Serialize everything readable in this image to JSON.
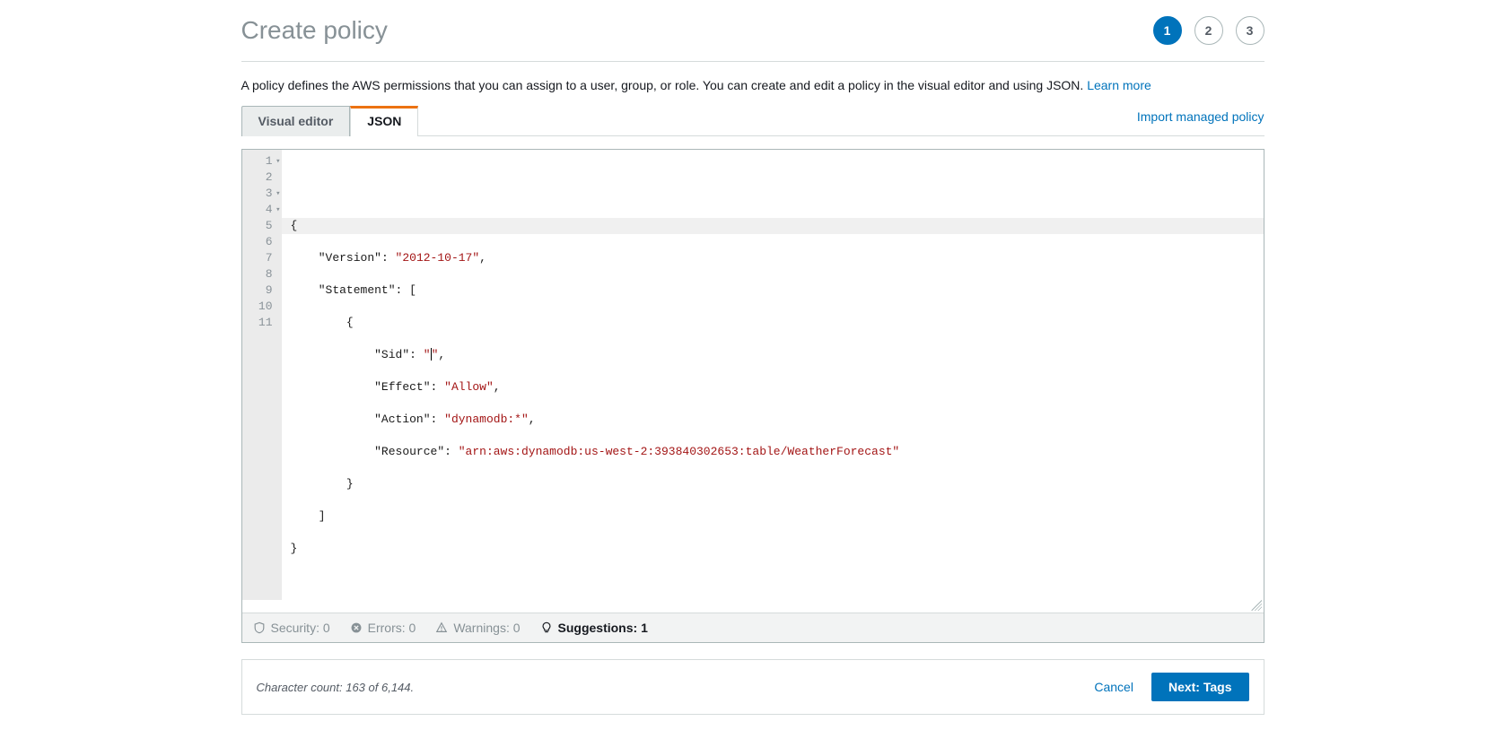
{
  "page_title": "Create policy",
  "steps": [
    "1",
    "2",
    "3"
  ],
  "active_step_index": 0,
  "description_text": "A policy defines the AWS permissions that you can assign to a user, group, or role. You can create and edit a policy in the visual editor and using JSON. ",
  "learn_more_label": "Learn more",
  "tabs": {
    "visual_label": "Visual editor",
    "json_label": "JSON"
  },
  "import_link_label": "Import managed policy",
  "editor": {
    "line_numbers": [
      "1",
      "2",
      "3",
      "4",
      "5",
      "6",
      "7",
      "8",
      "9",
      "10",
      "11"
    ],
    "fold_lines": [
      1,
      3,
      4
    ],
    "active_line_index": 5,
    "policy_json": {
      "Version": "2012-10-17",
      "Statement": [
        {
          "Sid": "",
          "Effect": "Allow",
          "Action": "dynamodb:*",
          "Resource": "arn:aws:dynamodb:us-west-2:393840302653:table/WeatherForecast"
        }
      ]
    },
    "tokens": {
      "l1": "{",
      "l2_k": "\"Version\"",
      "l2_v": "\"2012-10-17\"",
      "l3_k": "\"Statement\"",
      "l5_k": "\"Sid\"",
      "l6_k": "\"Effect\"",
      "l6_v": "\"Allow\"",
      "l7_k": "\"Action\"",
      "l7_v": "\"dynamodb:*\"",
      "l8_k": "\"Resource\"",
      "l8_v": "\"arn:aws:dynamodb:us-west-2:393840302653:table/WeatherForecast\""
    }
  },
  "status": {
    "security_label": "Security: 0",
    "errors_label": "Errors: 0",
    "warnings_label": "Warnings: 0",
    "suggestions_label": "Suggestions: 1"
  },
  "footer": {
    "char_count_text": "Character count: 163 of 6,144.",
    "cancel_label": "Cancel",
    "next_label": "Next: Tags"
  }
}
